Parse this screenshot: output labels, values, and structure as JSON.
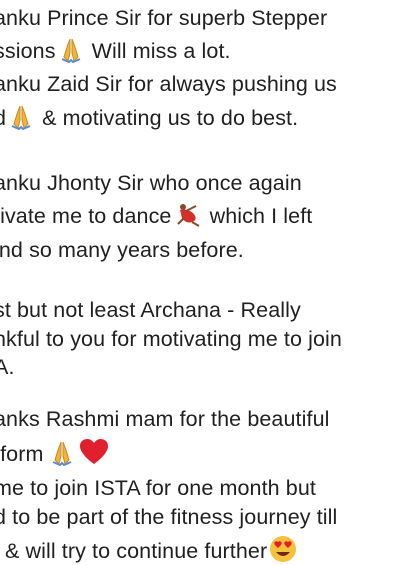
{
  "message": {
    "lines": [
      {
        "pre": "anku Prince Sir for superb Stepper",
        "emoji": "",
        "post": ""
      },
      {
        "pre": "ssions",
        "emoji": "folded-hands-emoji",
        "post": " Will miss a lot."
      },
      {
        "pre": "anku Zaid Sir for always pushing us",
        "emoji": "",
        "post": ""
      },
      {
        "pre": "d",
        "emoji": "folded-hands-emoji",
        "post": " & motivating us to do best."
      },
      {
        "pre": "anku Jhonty Sir who once again",
        "emoji": "",
        "post": ""
      },
      {
        "pre": "tivate me to dance",
        "emoji": "dancer-emoji",
        "post": " which I left"
      },
      {
        "pre": "ind so many years before.",
        "emoji": "",
        "post": ""
      },
      {
        "pre": "st but not least Archana - Really",
        "emoji": "",
        "post": ""
      },
      {
        "pre": "nkful to you for motivating me to join",
        "emoji": "",
        "post": ""
      },
      {
        "pre": "A.",
        "emoji": "",
        "post": ""
      },
      {
        "pre": "anks Rashmi mam for the beautiful",
        "emoji": "",
        "post": ""
      },
      {
        "pre": "tform",
        "emoji": "folded-hands-emoji",
        "post": "",
        "emoji2": "red-heart-emoji"
      },
      {
        "pre": "me to join ISTA for one month but",
        "emoji": "",
        "post": ""
      },
      {
        "pre": "d to be part of the fitness journey till",
        "emoji": "",
        "post": ""
      },
      {
        "pre": "l & will try to continue further",
        "emoji": "heart-eyes-emoji",
        "post": ""
      }
    ]
  },
  "colors": {
    "background": "#ffffff",
    "text": "#1f1f1f",
    "hands": "#f2b33d",
    "heart": "#e0202e",
    "dancer_dress": "#d4302a",
    "face": "#f7c23b"
  }
}
